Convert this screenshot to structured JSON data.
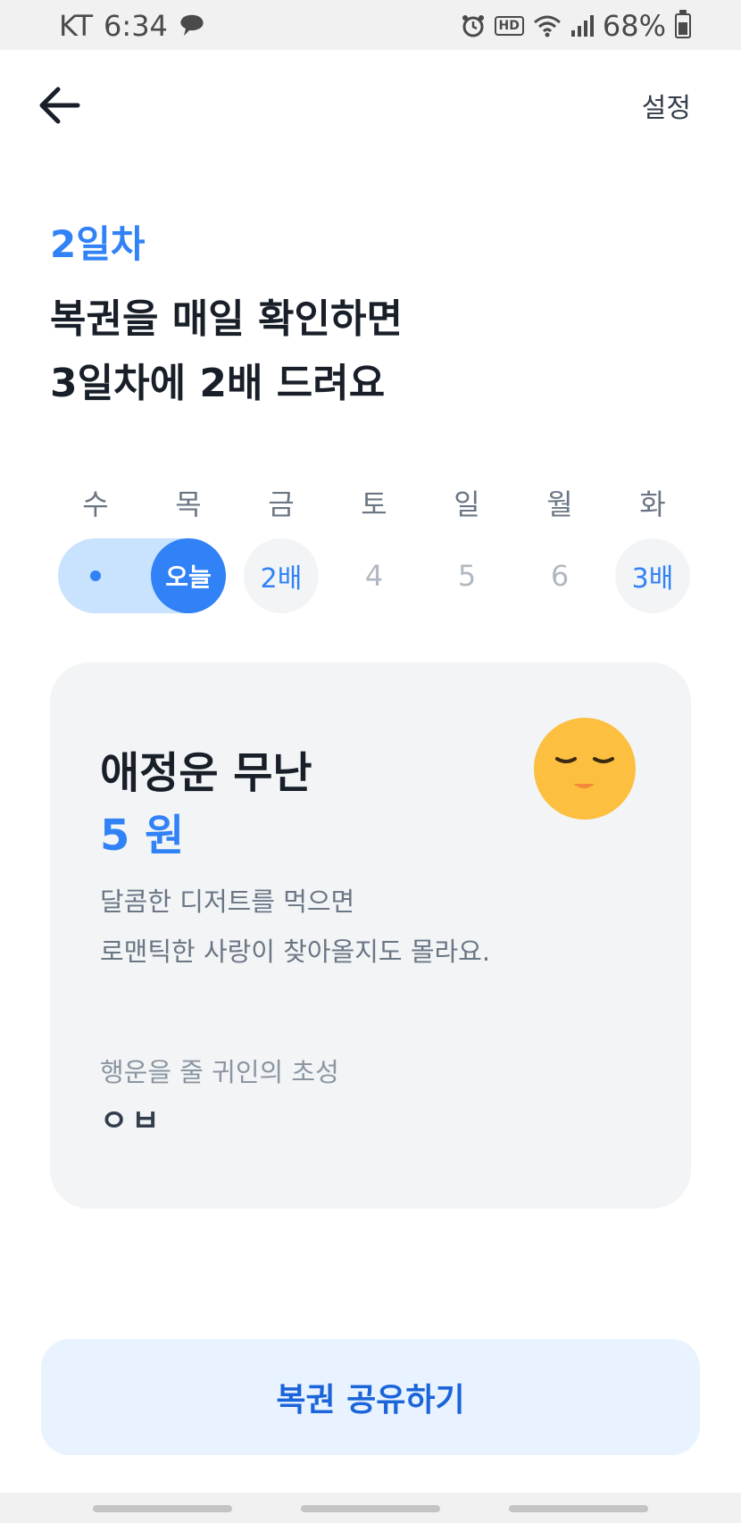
{
  "status_bar": {
    "carrier": "KT",
    "time": "6:34",
    "hd_badge": "HD",
    "battery": "68%"
  },
  "header": {
    "settings_label": "설정"
  },
  "title": {
    "day_label": "2일차",
    "headline_line1": "복권을 매일 확인하면",
    "headline_line2": "3일차에 2배 드려요"
  },
  "week": {
    "weekdays": [
      "수",
      "목",
      "금",
      "토",
      "일",
      "월",
      "화"
    ],
    "days": {
      "today_label": "오늘",
      "fri": "2배",
      "sat": "4",
      "sun": "5",
      "mon": "6",
      "tue": "3배"
    }
  },
  "fortune_card": {
    "title": "애정운 무난",
    "amount": "5 원",
    "description_line1": "달콤한 디저트를 먹으면",
    "description_line2": "로맨틱한 사랑이 찾아올지도 몰라요.",
    "hint_label": "행운을 줄 귀인의 초성",
    "hint_value": "ㅇㅂ",
    "face_color": "#fcbf3f"
  },
  "share_button": {
    "label": "복권 공유하기"
  },
  "colors": {
    "accent": "#3182f6",
    "accent_light": "#c9e2fd",
    "card_bg": "#f2f4f6",
    "share_bg": "#e8f3ff"
  }
}
